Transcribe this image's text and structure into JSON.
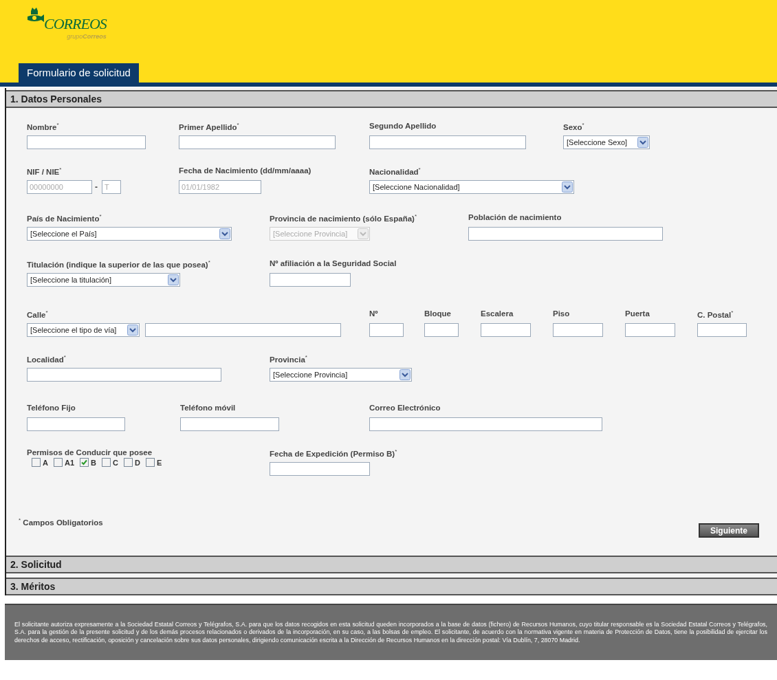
{
  "logo": {
    "name": "CORREOS",
    "group": "grupo**Correos**"
  },
  "page_tab": "Formulario de solicitud",
  "sections": [
    {
      "title": "1. Datos Personales"
    },
    {
      "title": "2. Solicitud"
    },
    {
      "title": "3. Méritos"
    }
  ],
  "form_rows": [
    [
      {
        "label": "Nombre$^{*}$",
        "controls": [
          {
            "kind": "text"
          }
        ]
      },
      {
        "label": "Primer Apellido$^{*}$",
        "controls": [
          {
            "kind": "text"
          }
        ]
      },
      {
        "label": "Segundo Apellido",
        "controls": [
          {
            "kind": "text"
          }
        ]
      },
      {
        "label": "Sexo$^{*}$",
        "controls": [
          {
            "kind": "select",
            "value": "[Seleccione Sexo]",
            "disabled": false
          }
        ]
      }
    ],
    [
      {
        "label": "NIF / NIE$^{*}$",
        "controls": [
          {
            "kind": "text",
            "placeholder": "00000000"
          },
          {
            "kind": "separator",
            "text": "-"
          },
          {
            "kind": "text",
            "placeholder": "T"
          }
        ]
      },
      {
        "label": "Fecha de Nacimiento (dd/mm/aaaa)",
        "controls": [
          {
            "kind": "text",
            "placeholder": "01/01/1982"
          }
        ]
      },
      {
        "label": "Nacionalidad$^{*}$",
        "controls": [
          {
            "kind": "select",
            "value": "[Seleccione Nacionalidad]",
            "disabled": false
          }
        ]
      }
    ],
    [
      {
        "label": "País de Nacimiento$^{*}$",
        "controls": [
          {
            "kind": "select",
            "value": "[Seleccione el País]",
            "disabled": false
          }
        ]
      },
      {
        "label": "Provincia de nacimiento (sólo España)$^{*}$",
        "controls": [
          {
            "kind": "select",
            "value": "[Seleccione Provincia]",
            "disabled": true
          }
        ]
      },
      {
        "label": "Población de nacimiento",
        "controls": [
          {
            "kind": "text"
          }
        ]
      }
    ],
    [
      {
        "label": "Titulación (indique la superior de las que posea)$^{*}$",
        "controls": [
          {
            "kind": "select",
            "value": "[Seleccione la titulación]",
            "disabled": false
          }
        ]
      },
      {
        "label": "Nº afiliación a la Seguridad Social",
        "controls": [
          {
            "kind": "text"
          }
        ]
      }
    ],
    [
      {
        "label": "Calle$^{*}$",
        "controls": [
          {
            "kind": "select",
            "value": "[Seleccione el tipo de vía]",
            "disabled": false
          },
          {
            "kind": "text"
          }
        ]
      },
      {
        "label": "Nº",
        "controls": [
          {
            "kind": "text"
          }
        ]
      },
      {
        "label": "Bloque",
        "controls": [
          {
            "kind": "text"
          }
        ]
      },
      {
        "label": "Escalera",
        "controls": [
          {
            "kind": "text"
          }
        ]
      },
      {
        "label": "Piso",
        "controls": [
          {
            "kind": "text"
          }
        ]
      },
      {
        "label": "Puerta",
        "controls": [
          {
            "kind": "text"
          }
        ]
      },
      {
        "label": "C. Postal$^{*}$",
        "controls": [
          {
            "kind": "text"
          }
        ]
      }
    ],
    [
      {
        "label": "Localidad$^{*}$",
        "controls": [
          {
            "kind": "text"
          }
        ]
      },
      {
        "label": "Provincia$^{*}$",
        "controls": [
          {
            "kind": "select",
            "value": "[Seleccione Provincia]",
            "disabled": false
          }
        ]
      }
    ],
    [
      {
        "label": "Teléfono Fijo",
        "controls": [
          {
            "kind": "text"
          }
        ]
      },
      {
        "label": "Teléfono móvil",
        "controls": [
          {
            "kind": "text"
          }
        ]
      },
      {
        "label": "Correo Electrónico",
        "controls": [
          {
            "kind": "text"
          }
        ]
      }
    ],
    [
      {
        "label": "Permisos de Conducir que posee",
        "controls": [
          {
            "kind": "checkboxes",
            "options": [
              {
                "label": "A",
                "checked": false
              },
              {
                "label": "A1",
                "checked": false
              },
              {
                "label": "B",
                "checked": true
              },
              {
                "label": "C",
                "checked": false
              },
              {
                "label": "D",
                "checked": false
              },
              {
                "label": "E",
                "checked": false
              }
            ]
          }
        ]
      },
      {
        "label": "Fecha de Expedición (Permiso B)$^{*}$",
        "controls": [
          {
            "kind": "text"
          }
        ]
      }
    ]
  ],
  "required_note": "$^{*}$ Campos Obligatorios",
  "next_button": "Siguiente",
  "legal_notice": "El solicitante autoriza expresamente a la Sociedad Estatal Correos y Telégrafos, S.A. para que los datos recogidos en esta solicitud queden incorporados a la base de datos (fichero) de Recursos Humanos, cuyo titular responsable es la Sociedad Estatal Correos y Telégrafos, S.A. para la gestión de la presente solicitud y de los demás procesos relacionados o derivados de la incorporación, en su caso, a las bolsas de empleo. El solicitante, de acuerdo con la normativa vigente en materia de Protección de Datos, tiene la posibilidad de ejercitar los derechos de acceso, rectificación, oposición y cancelación sobre sus datos personales, dirigiendo comunicación escrita a la Dirección de Recursos Humanos en la dirección postal: Vía Dublín, 7, 28070 Madrid."
}
